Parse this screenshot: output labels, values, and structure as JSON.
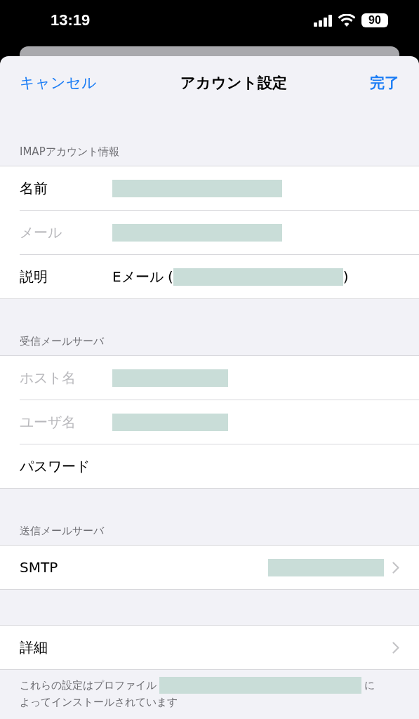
{
  "status_bar": {
    "time": "13:19",
    "battery": "90"
  },
  "nav": {
    "cancel": "キャンセル",
    "title": "アカウント設定",
    "done": "完了"
  },
  "sections": [
    {
      "header": "IMAPアカウント情報",
      "rows": [
        {
          "label": "名前",
          "disabled": false,
          "chevron": false,
          "value": [
            {
              "kind": "redacted-long"
            }
          ]
        },
        {
          "label": "メール",
          "disabled": true,
          "chevron": false,
          "value": [
            {
              "kind": "redacted-long"
            }
          ]
        },
        {
          "label": "説明",
          "disabled": false,
          "chevron": false,
          "value": [
            {
              "kind": "text",
              "text": "Eメール ("
            },
            {
              "kind": "redacted-long"
            },
            {
              "kind": "text",
              "text": ")"
            }
          ]
        }
      ]
    },
    {
      "header": "受信メールサーバ",
      "rows": [
        {
          "label": "ホスト名",
          "disabled": true,
          "chevron": false,
          "value": [
            {
              "kind": "redacted-short"
            }
          ]
        },
        {
          "label": "ユーザ名",
          "disabled": true,
          "chevron": false,
          "value": [
            {
              "kind": "redacted-short"
            }
          ]
        },
        {
          "label": "パスワード",
          "disabled": false,
          "chevron": false,
          "value": []
        }
      ]
    },
    {
      "header": "送信メールサーバ",
      "rows": [
        {
          "label": "SMTP",
          "disabled": false,
          "chevron": true,
          "value": [
            {
              "kind": "redacted-short-right"
            }
          ]
        }
      ]
    },
    {
      "rows": [
        {
          "label": "詳細",
          "disabled": false,
          "chevron": true,
          "value": []
        }
      ]
    }
  ],
  "footer": [
    [
      {
        "kind": "text",
        "text": "これらの設定はプロファイル"
      },
      {
        "kind": "redacted-long"
      },
      {
        "kind": "text",
        "text": "に"
      }
    ],
    [
      {
        "kind": "text",
        "text": "よってインストールされています"
      }
    ]
  ]
}
